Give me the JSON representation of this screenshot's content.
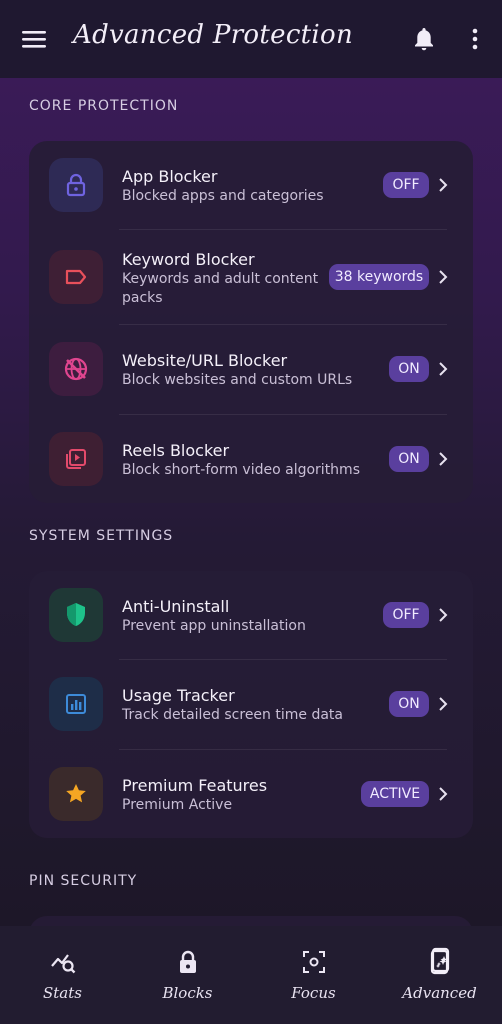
{
  "header": {
    "title": "Advanced Protection",
    "menu_icon": "hamburger-menu-icon",
    "bell_icon": "bell-icon",
    "more_icon": "more-vertical-icon"
  },
  "sections": {
    "core": {
      "title": "CORE PROTECTION",
      "items": [
        {
          "label": "App Blocker",
          "sub": "Blocked apps and categories",
          "badge": "OFF",
          "icon": "lock-icon"
        },
        {
          "label": "Keyword Blocker",
          "sub1": "Keywords and adult content",
          "sub2": "packs",
          "badge": "38 keywords",
          "icon": "tag-icon"
        },
        {
          "label": "Website/URL Blocker",
          "sub": "Block websites and custom URLs",
          "badge": "ON",
          "icon": "no-web-icon"
        },
        {
          "label": "Reels Blocker",
          "sub": "Block short-form video algorithms",
          "badge": "ON",
          "icon": "video-library-icon"
        }
      ]
    },
    "system": {
      "title": "SYSTEM SETTINGS",
      "items": [
        {
          "label": "Anti-Uninstall",
          "sub": "Prevent app uninstallation",
          "badge": "OFF",
          "icon": "shield-icon"
        },
        {
          "label": "Usage Tracker",
          "sub": "Track detailed screen time data",
          "badge": "ON",
          "icon": "bar-chart-icon"
        },
        {
          "label": "Premium Features",
          "sub": "Premium Active",
          "badge": "ACTIVE",
          "icon": "star-icon"
        }
      ]
    },
    "pin": {
      "title": "PIN SECURITY"
    }
  },
  "nav": {
    "items": [
      {
        "label": "Stats",
        "icon": "stats-search-icon"
      },
      {
        "label": "Blocks",
        "icon": "lock-icon"
      },
      {
        "label": "Focus",
        "icon": "focus-icon"
      },
      {
        "label": "Advanced",
        "icon": "phone-sparkle-icon"
      }
    ],
    "active": "Advanced"
  },
  "colors": {
    "badge": "#5a3f9e",
    "lock_icon": "#6f63e0",
    "tag_icon": "#e8505b",
    "web_icon": "#e0458f",
    "reels_icon": "#e34a6b",
    "shield_icon": "#1ec28a",
    "chart_icon": "#3d8bd9",
    "star_icon": "#f5a623"
  }
}
